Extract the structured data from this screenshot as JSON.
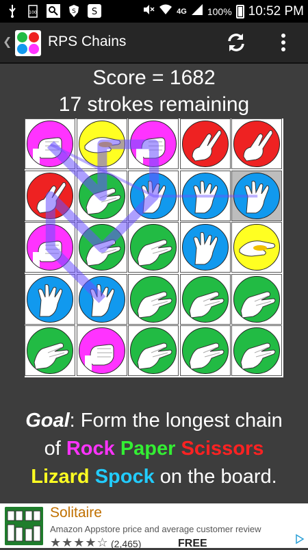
{
  "status_bar": {
    "network": "4G",
    "battery": "100%",
    "time": "10:52 PM"
  },
  "app": {
    "title": "RPS Chains"
  },
  "game": {
    "score": "Score = 1682",
    "strokes": "17 strokes remaining",
    "board": [
      [
        "rock",
        "lizard",
        "rock",
        "scissors",
        "scissors"
      ],
      [
        "scissors",
        "paper",
        "spock",
        "spock",
        "spock"
      ],
      [
        "rock",
        "paper",
        "paper",
        "spock",
        "lizard"
      ],
      [
        "spock",
        "spock",
        "paper",
        "paper",
        "paper"
      ],
      [
        "paper",
        "rock",
        "paper",
        "paper",
        "paper"
      ]
    ],
    "selected_cell": [
      1,
      4
    ],
    "colors": {
      "rock": "#ff33ff",
      "paper": "#22bb44",
      "scissors": "#ee2222",
      "lizard": "#ffff22",
      "spock": "#1199ee"
    }
  },
  "goal": {
    "label": "Goal",
    "line1_rest": ": Form the longest chain",
    "of": "of ",
    "rock": "Rock",
    "paper": "Paper",
    "scissors": "Scissors",
    "lizard": "Lizard",
    "spock": "Spock",
    "tail": " on the board."
  },
  "ad": {
    "title": "Solitaire",
    "description": "Amazon Appstore price and average customer review",
    "stars": "★★★★☆",
    "rating_count": "(2,465)",
    "price": "FREE"
  }
}
